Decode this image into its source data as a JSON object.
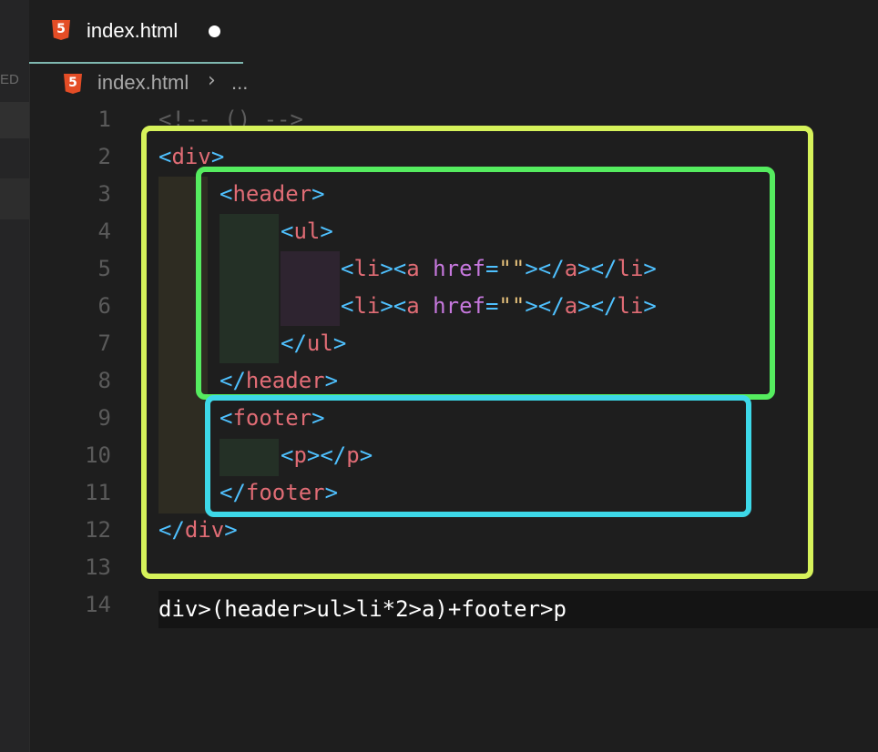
{
  "sidebar": {
    "label_fragment": "ED"
  },
  "tab": {
    "filename": "index.html",
    "icon": "html5-icon",
    "icon_glyph": "5",
    "modified": true
  },
  "breadcrumb": {
    "file": "index.html",
    "separator": "›",
    "more": "..."
  },
  "lines": [
    {
      "num": "1"
    },
    {
      "num": "2"
    },
    {
      "num": "3"
    },
    {
      "num": "4"
    },
    {
      "num": "5"
    },
    {
      "num": "6"
    },
    {
      "num": "7"
    },
    {
      "num": "8"
    },
    {
      "num": "9"
    },
    {
      "num": "10"
    },
    {
      "num": "11"
    },
    {
      "num": "12"
    },
    {
      "num": "13"
    },
    {
      "num": "14"
    }
  ],
  "code": {
    "l1": "<!-- () -->",
    "l2_open": "<",
    "l2_tag": "div",
    "l2_close": ">",
    "l3_open": "<",
    "l3_tag": "header",
    "l3_close": ">",
    "l4_open": "<",
    "l4_tag": "ul",
    "l4_close": ">",
    "li_open": "<",
    "li_tag": "li",
    "li_mid": "><",
    "a_tag": "a",
    "space": " ",
    "attr": "href",
    "eq": "=",
    "str": "\"\"",
    "gt": ">",
    "close_a_open": "</",
    "close_a_tag": "a",
    "close_li_mid": "></",
    "close_li_tag": "li",
    "close_end": ">",
    "l7_open": "</",
    "l7_tag": "ul",
    "l7_close": ">",
    "l8_open": "</",
    "l8_tag": "header",
    "l8_close": ">",
    "l9_open": "<",
    "l9_tag": "footer",
    "l9_close": ">",
    "l10_open": "<",
    "l10_tag": "p",
    "l10_mid": "></",
    "l10_tag2": "p",
    "l10_close": ">",
    "l11_open": "</",
    "l11_tag": "footer",
    "l11_close": ">",
    "l12_open": "</",
    "l12_tag": "div",
    "l12_close": ">",
    "l14": "div>(header>ul>li*2>a)+footer>p"
  },
  "colors": {
    "yellow_box": "#d6f25a",
    "green_box": "#55ec5f",
    "cyan_box": "#3dd8e8",
    "tag_bracket": "#4fc1ff",
    "tag_name": "#e06c75",
    "attribute": "#c678dd",
    "string": "#e5c07b"
  }
}
